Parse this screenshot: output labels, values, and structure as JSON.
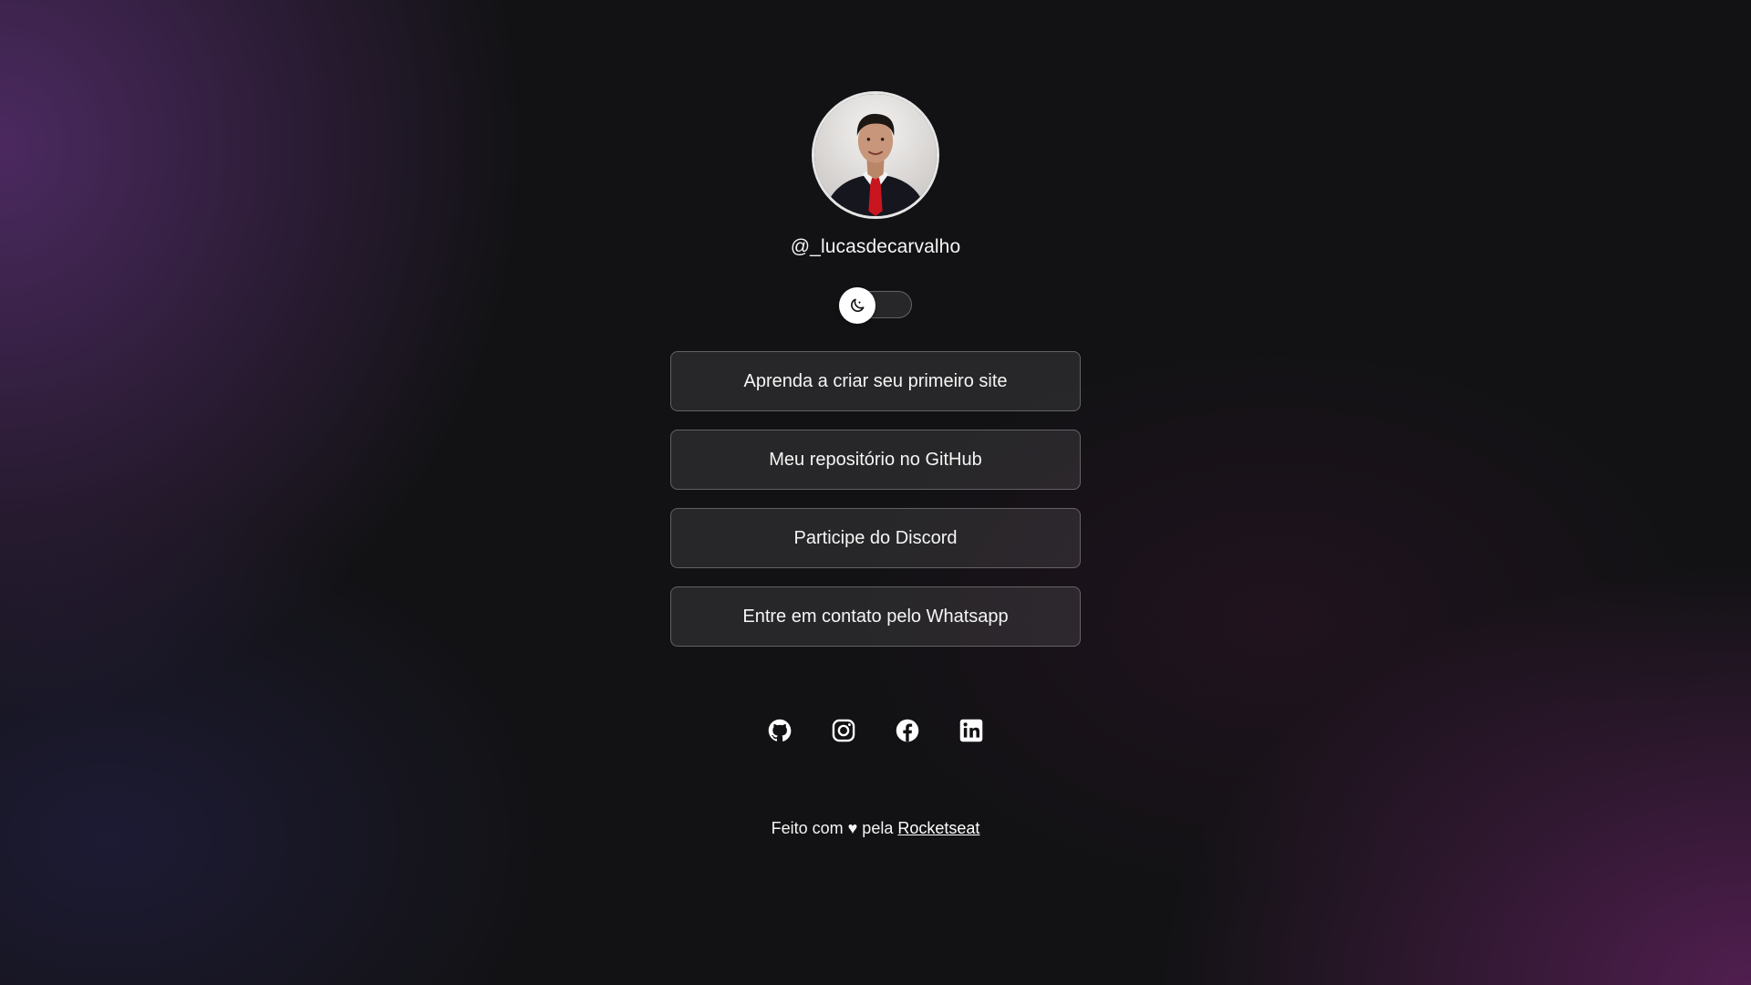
{
  "profile": {
    "avatar_alt": "Foto de Lucas de Carvalho",
    "handle": "@_lucasdecarvalho"
  },
  "theme_switch": {
    "icon": "moon-icon",
    "state": "dark"
  },
  "links": [
    {
      "label": "Aprenda a criar seu primeiro site"
    },
    {
      "label": "Meu repositório no GitHub"
    },
    {
      "label": "Participe do Discord"
    },
    {
      "label": "Entre em contato pelo Whatsapp"
    }
  ],
  "social": [
    {
      "icon": "github-icon"
    },
    {
      "icon": "instagram-icon"
    },
    {
      "icon": "facebook-icon"
    },
    {
      "icon": "linkedin-icon"
    }
  ],
  "footer": {
    "prefix": "Feito com ♥ pela ",
    "link_label": "Rocketseat"
  },
  "colors": {
    "background": "#121214",
    "accent_purple": "#5c3076",
    "accent_magenta": "#622260",
    "surface": "#2a282d",
    "border": "#474549",
    "text": "#f5f5f5"
  }
}
